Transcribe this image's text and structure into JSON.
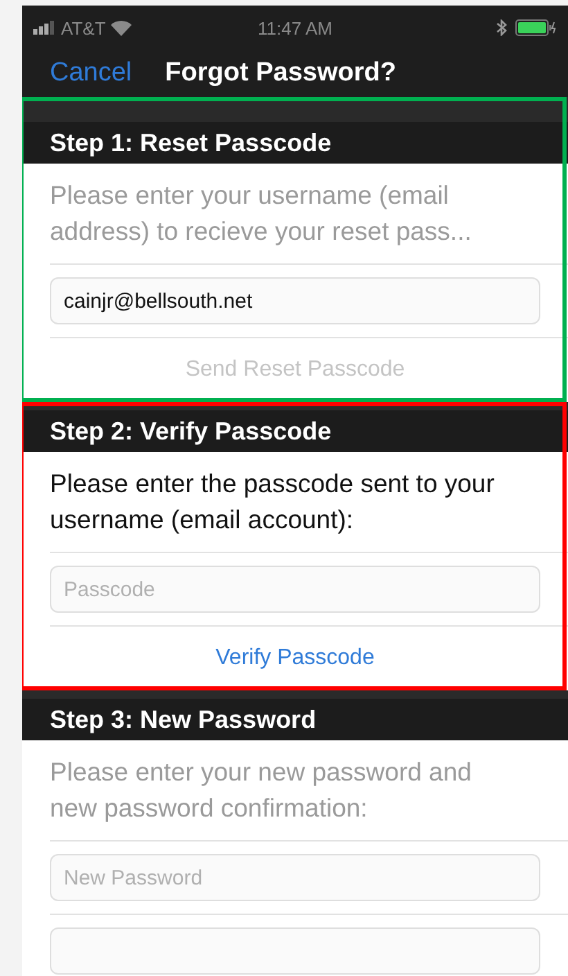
{
  "status_bar": {
    "carrier": "AT&T",
    "time": "11:47 AM"
  },
  "nav_bar": {
    "cancel": "Cancel",
    "title": "Forgot Password?"
  },
  "steps": [
    {
      "title": "Step 1: Reset Passcode",
      "active": false,
      "color": "#00b050",
      "description": "Please enter your username (email address) to recieve your reset pass...",
      "fields": [
        {
          "kind": "value",
          "text": "cainjr@bellsouth.net"
        }
      ],
      "action": {
        "label": "Send Reset Passcode",
        "disabled": true
      }
    },
    {
      "title": "Step 2: Verify Passcode",
      "active": true,
      "color": "#ff0000",
      "description": "Please enter the passcode sent to your username (email account):",
      "fields": [
        {
          "kind": "placeholder",
          "text": "Passcode"
        }
      ],
      "action": {
        "label": "Verify Passcode",
        "disabled": false
      }
    },
    {
      "title": "Step 3: New Password",
      "active": false,
      "description": "Please enter your new password and new password confirmation:",
      "fields": [
        {
          "kind": "placeholder",
          "text": "New Password"
        },
        {
          "kind": "empty"
        }
      ]
    }
  ]
}
